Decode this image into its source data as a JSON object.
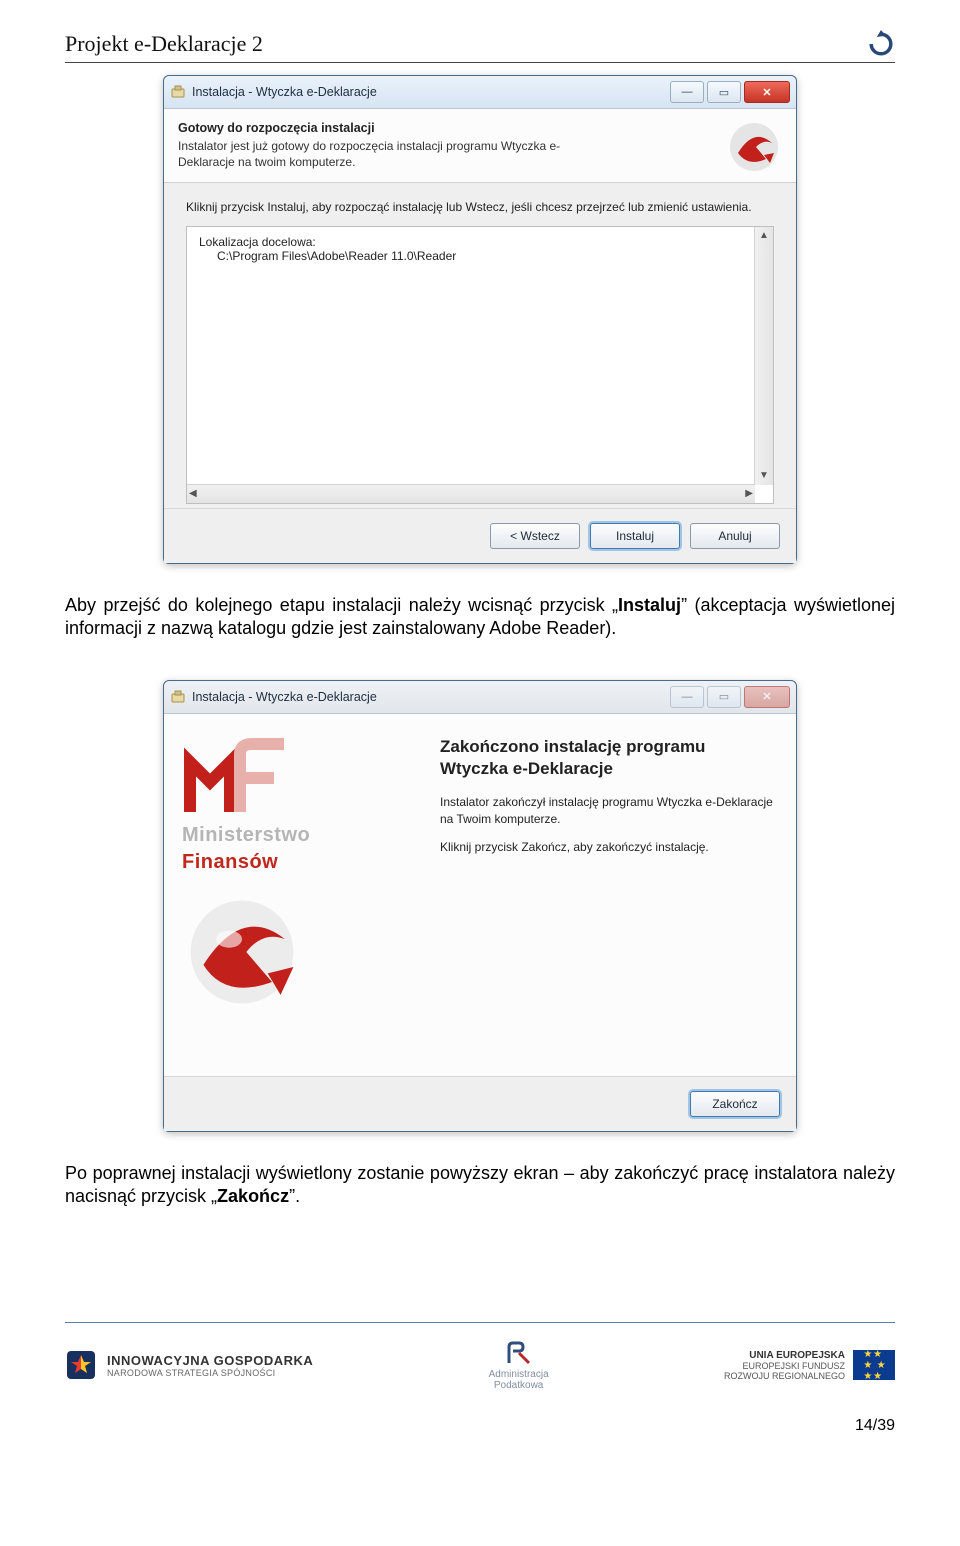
{
  "doc": {
    "title": "Projekt e-Deklaracje 2",
    "page_num": "14/39"
  },
  "win1": {
    "title": "Instalacja - Wtyczka e-Deklaracje",
    "step_title": "Gotowy do rozpoczęcia instalacji",
    "step_sub": "Instalator jest już gotowy do rozpoczęcia instalacji programu Wtyczka e-Deklaracje na twoim komputerze.",
    "hint": "Kliknij przycisk Instaluj, aby rozpocząć instalację lub Wstecz, jeśli chcesz przejrzeć lub zmienić ustawienia.",
    "loc_label": "Lokalizacja docelowa:",
    "loc_value": "C:\\Program Files\\Adobe\\Reader 11.0\\Reader",
    "btn_back": "<  Wstecz",
    "btn_install": "Instaluj",
    "btn_cancel": "Anuluj"
  },
  "para1_pre": "Aby przejść do kolejnego etapu instalacji należy wcisnąć przycisk „",
  "para1_bold": "Instaluj",
  "para1_post": "” (akceptacja wyświetlonej informacji z nazwą katalogu gdzie jest zainstalowany Adobe Reader).",
  "win2": {
    "title": "Instalacja - Wtyczka e-Deklaracje",
    "done_title": "Zakończono instalację programu Wtyczka e-Deklaracje",
    "line1": "Instalator zakończył instalację programu Wtyczka e-Deklaracje na Twoim komputerze.",
    "line2": "Kliknij przycisk Zakończ, aby zakończyć instalację.",
    "logo1": "Ministerstwo",
    "logo2": "Finansów",
    "btn_finish": "Zakończ"
  },
  "para2_pre": "Po poprawnej instalacji wyświetlony zostanie powyższy ekran – aby zakończyć pracę instalatora należy nacisnąć przycisk „",
  "para2_bold": "Zakończ",
  "para2_post": "”.",
  "footer": {
    "ig1": "INNOWACYJNA GOSPODARKA",
    "ig2": "NARODOWA STRATEGIA SPÓJNOŚCI",
    "ap1": "Administracja",
    "ap2": "Podatkowa",
    "eu1": "UNIA EUROPEJSKA",
    "eu2": "EUROPEJSKI FUNDUSZ",
    "eu3": "ROZWOJU REGIONALNEGO"
  }
}
